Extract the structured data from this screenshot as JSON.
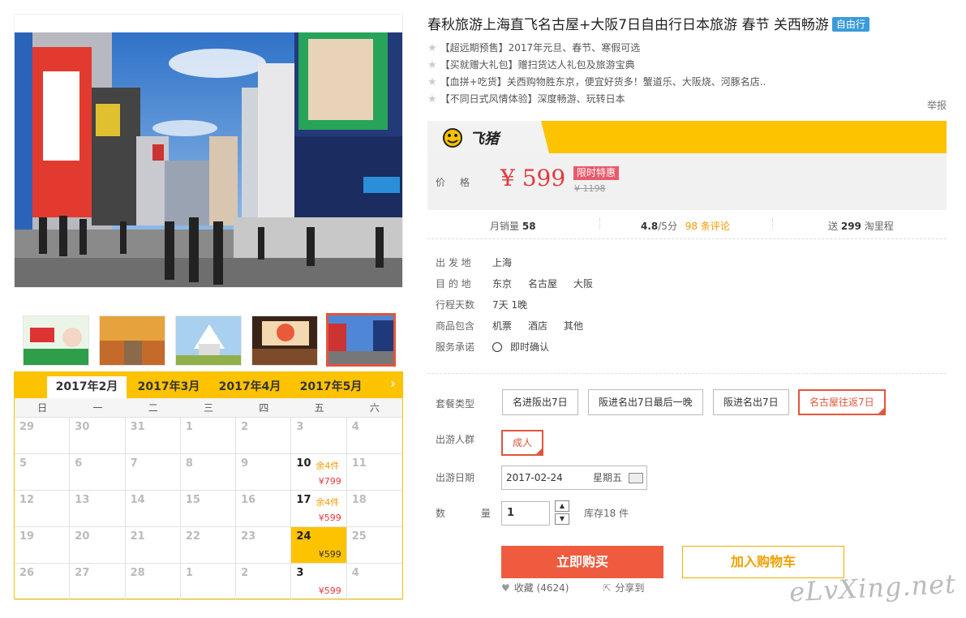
{
  "product": {
    "title": "春秋旅游上海直飞名古屋+大阪7日自由行日本旅游 春节 关西畅游",
    "tag": "自由行",
    "features": [
      "【超远期预售】2017年元旦、春节、寒假可选",
      "【买就赠大礼包】赠扫货达人礼包及旅游宝典",
      "【血拼+吃货】关西购物胜东京，便宜好货多！蟹道乐、大阪烧、河豚名店..",
      "【不同日式风情体验】深度畅游、玩转日本"
    ],
    "report": "举报"
  },
  "brand": {
    "name": "飞猪"
  },
  "price": {
    "label": "价格",
    "value": "¥ 599",
    "promo": "限时特惠",
    "original": "¥ 1198"
  },
  "stats": {
    "monthly_label": "月销量",
    "monthly_value": "58",
    "rating_value": "4.8",
    "rating_unit": "/5分",
    "reviews": "98 条评论",
    "mileage_prefix": "送",
    "mileage_value": "299",
    "mileage_suffix": "淘里程"
  },
  "info": [
    {
      "key": "出 发 地",
      "values": [
        "上海"
      ]
    },
    {
      "key": "目 的 地",
      "values": [
        "东京",
        "名古屋",
        "大阪"
      ]
    },
    {
      "key": "行程天数",
      "values": [
        "7天 1晚"
      ]
    },
    {
      "key": "商品包含",
      "values": [
        "机票",
        "酒店",
        "其他"
      ]
    },
    {
      "key": "服务承诺",
      "values": [
        "即时确认"
      ]
    }
  ],
  "options": {
    "package_label": "套餐类型",
    "packages": [
      "名进阪出7日",
      "阪进名出7日最后一晚",
      "阪进名出7日",
      "名古屋往返7日"
    ],
    "selected_package": 3,
    "crowd_label": "出游人群",
    "crowd": [
      "成人"
    ],
    "date_label": "出游日期",
    "date_value": "2017-02-24",
    "weekday": "星期五",
    "qty_label": "数  量",
    "qty_value": "1",
    "stock": "库存18 件"
  },
  "actions": {
    "buy": "立即购买",
    "cart": "加入购物车",
    "favorite": "收藏 (4624)",
    "share": "分享到"
  },
  "calendar": {
    "tabs": [
      "2017年2月",
      "2017年3月",
      "2017年4月",
      "2017年5月"
    ],
    "active_tab": 0,
    "weekdays": [
      "日",
      "一",
      "二",
      "三",
      "四",
      "五",
      "六"
    ],
    "cells": [
      {
        "d": "29"
      },
      {
        "d": "30"
      },
      {
        "d": "31"
      },
      {
        "d": "1"
      },
      {
        "d": "2"
      },
      {
        "d": "3"
      },
      {
        "d": "4"
      },
      {
        "d": "5"
      },
      {
        "d": "6"
      },
      {
        "d": "7"
      },
      {
        "d": "8"
      },
      {
        "d": "9"
      },
      {
        "d": "10",
        "left": "余4件",
        "price": "¥799"
      },
      {
        "d": "11"
      },
      {
        "d": "12"
      },
      {
        "d": "13"
      },
      {
        "d": "14"
      },
      {
        "d": "15"
      },
      {
        "d": "16"
      },
      {
        "d": "17",
        "left": "余4件",
        "price": "¥599"
      },
      {
        "d": "18"
      },
      {
        "d": "19"
      },
      {
        "d": "20"
      },
      {
        "d": "21"
      },
      {
        "d": "22"
      },
      {
        "d": "23"
      },
      {
        "d": "24",
        "price": "¥599",
        "selected": true
      },
      {
        "d": "25"
      },
      {
        "d": "26"
      },
      {
        "d": "27"
      },
      {
        "d": "28"
      },
      {
        "d": "1"
      },
      {
        "d": "2"
      },
      {
        "d": "3",
        "price": "¥599"
      },
      {
        "d": "4"
      }
    ]
  },
  "watermark": "eLvXing.net",
  "colors": {
    "accent": "#fdc300",
    "buy": "#ef5b3e",
    "price": "#e4393c",
    "select": "#e1563c"
  }
}
